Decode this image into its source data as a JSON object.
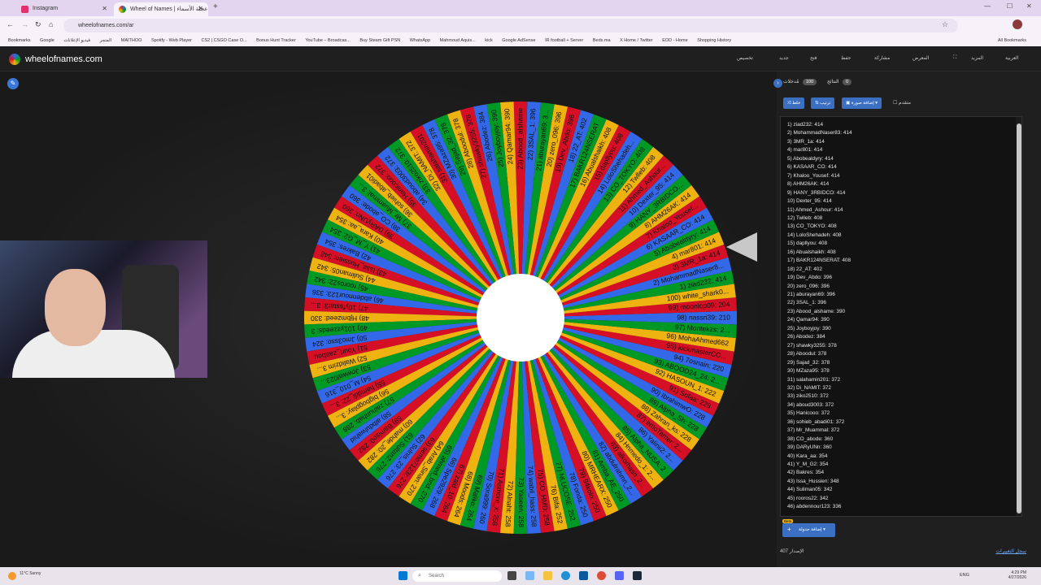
{
  "browser": {
    "tabs": [
      {
        "title": "Instagram",
        "active": false
      },
      {
        "title": "Wheel of Names | عجلة الأسماء",
        "active": true
      }
    ],
    "url": "wheelofnames.com/ar",
    "bookmarks": [
      "Bookmarks",
      "Google",
      "فيديو الإعلانات",
      "المتجر",
      "MAITHOO",
      "Spotify - Web Player",
      "CS2 | CSGO Case O...",
      "Bonus Hunt Tracker",
      "YouTube – Broadcas...",
      "Buy Steam Gift PSN",
      "WhatsApp",
      "Mahmoud Aquis...",
      "kick",
      "Google AdSense",
      "IR football + Server",
      "Beds.ma",
      "X Home / Twitter",
      "EOD - Home",
      "Shopping History",
      "All Bookmarks"
    ]
  },
  "app": {
    "site_name": "wheelofnames.com",
    "header_items": [
      "تخصيص",
      "جديد",
      "فتح",
      "حفظ",
      "مشاركة",
      "المعرض",
      "المزيد",
      "العربية"
    ]
  },
  "panel": {
    "tab_entries": "مُدخلات",
    "tab_entries_count": "100",
    "tab_results": "النتائج",
    "tab_results_count": "0",
    "btn_shuffle": "خلط",
    "btn_sort": "ترتيب",
    "btn_add_image": "إضافة صورة",
    "advanced_label": "متقدم",
    "beta": "Beta",
    "add_sheet": "إضافة جدولة",
    "version": "407 الإصدار",
    "changelog": "سجل التغييرات"
  },
  "entries": [
    "1) ziad232: 414",
    "2) MohammadNaser83: 414",
    "3) 3MR_1a: 414",
    "4) mar801: 414",
    "5) Abobealdyry: 414",
    "6) KASAAR_CO: 414",
    "7) Khaloo_Yousef: 414",
    "8) AHM26AK: 414",
    "9) HANY_3RBIDCO: 414",
    "10) Dexter_95: 414",
    "11) Ahmed_Ashour: 414",
    "12) Twlleb: 408",
    "13) CO_TOKYO: 408",
    "14) LoloShehadeh: 408",
    "15) dapllyou: 408",
    "16) Abualshaikh: 408",
    "17) BAKR124NSERAT: 408",
    "18) 22_AT: 402",
    "19) Dev_Abdo: 396",
    "20) zero_096: 396",
    "21) aburayan69: 396",
    "22) 3SAL_1: 396",
    "23) Abood_alshame: 390",
    "24) Qamar94: 390",
    "25) Joyboyjoy: 390",
    "26) Abodez: 384",
    "27) shawky3255: 378",
    "28) Aboodul: 378",
    "29) Sajad_32: 378",
    "30) MZaza95: 378",
    "31) salahamin201: 372",
    "32) Di_NAMIT: 372",
    "33) ziko2510: 372",
    "34) aboud3003: 372",
    "35) Hanicooo: 372",
    "36) sohieb_abadi01: 372",
    "37) Mr_Muammal: 372",
    "38) CO_abode: 360",
    "39) DARyUNn: 360",
    "40) Kara_aa: 354",
    "41) Y_M_G2: 354",
    "42) Bakres: 354",
    "43) Issa_Hussien: 348",
    "44) Suliman05: 342",
    "45) rooros22: 342",
    "46) abdennour123: 336"
  ],
  "wheel": {
    "segment_count": 100,
    "colors": [
      "#3369e8",
      "#d50f25",
      "#eeb211",
      "#009925"
    ],
    "visible_labels": [
      {
        "n": 97,
        "text": "97) Montekzs: 2..."
      },
      {
        "n": 98,
        "text": "98) nassri39: 210"
      },
      {
        "n": 99,
        "text": "99) moonlop09: 204"
      },
      {
        "n": 100,
        "text": "100) white_shark0..."
      },
      {
        "n": 1,
        "text": "1) ziad232: 414"
      },
      {
        "n": 2,
        "text": "2) MohammadNaser8..."
      },
      {
        "n": 3,
        "text": "3) 3MR_1a: 414"
      },
      {
        "n": 4,
        "text": "4) mar801: 414"
      },
      {
        "n": 5,
        "text": "5) Abobealdyry: 414"
      },
      {
        "n": 6,
        "text": "6) KASAAR_CO: 414"
      },
      {
        "n": 7,
        "text": "7) Khaloo_Yousef..."
      },
      {
        "n": 8,
        "text": "8) AHM26AK: 414"
      },
      {
        "n": 9,
        "text": "9) HANY_3RBIDCO..."
      },
      {
        "n": 10,
        "text": "10) Dexter_95: 414"
      },
      {
        "n": 11,
        "text": "11) Ahmed_Ashour..."
      },
      {
        "n": 12,
        "text": "12) Twlleb: 408"
      },
      {
        "n": 13,
        "text": "13) CO_TOKYO: 408"
      },
      {
        "n": 14,
        "text": "14) LoloShehadeh..."
      },
      {
        "n": 15,
        "text": "15) dapllyou: 408"
      },
      {
        "n": 16,
        "text": "16) Abualshaikh: 408"
      },
      {
        "n": 17,
        "text": "17) BAKR124NSERAT"
      },
      {
        "n": 18,
        "text": "18) 22_AT: 402"
      },
      {
        "n": 19,
        "text": "19) Dev_Abdo: 396"
      },
      {
        "n": 20,
        "text": "20) zero_096: 396"
      },
      {
        "n": 21,
        "text": "21) aburayan69: 3..."
      },
      {
        "n": 22,
        "text": "22) 3SAL_1: 396"
      },
      {
        "n": 23,
        "text": "23) Abood_alshame"
      },
      {
        "n": 24,
        "text": "24) Qamar94: 390"
      },
      {
        "n": 25,
        "text": "25) Joyboyjoy: 390"
      },
      {
        "n": 26,
        "text": "26) Abodez: 384"
      },
      {
        "n": 27,
        "text": "27) shawky3255: 378"
      },
      {
        "n": 28,
        "text": "28) Aboodul: 378"
      },
      {
        "n": 29,
        "text": "29) Sajad_32: 378"
      },
      {
        "n": 30,
        "text": "30) MZaza95: 378"
      },
      {
        "n": 31,
        "text": "31) salahamin201"
      },
      {
        "n": 32,
        "text": "32) Di_NAMIT: 372"
      },
      {
        "n": 33,
        "text": "33) ziko2510: 372"
      },
      {
        "n": 34,
        "text": "34) aboud3003: 372"
      },
      {
        "n": 35,
        "text": "35) Hanicooo: 372"
      },
      {
        "n": 36,
        "text": "36) sohieb_abadi01"
      },
      {
        "n": 37,
        "text": "37) Mr_Muammal: 3..."
      },
      {
        "n": 38,
        "text": "38) CO_abode: 360"
      },
      {
        "n": 39,
        "text": "39) DARyUNn: 360"
      },
      {
        "n": 40,
        "text": "40) Kara_aa: 354"
      },
      {
        "n": 41,
        "text": "41) Y_M_G2: 354"
      },
      {
        "n": 42,
        "text": "42) Bakres: 354"
      },
      {
        "n": 43,
        "text": "43) Issa_Hussien: 348"
      },
      {
        "n": 44,
        "text": "44) Suliman05: 342"
      },
      {
        "n": 45,
        "text": "45) rooros22: 342"
      },
      {
        "n": 46,
        "text": "46) abdennour123: 336"
      },
      {
        "n": 47,
        "text": "47) 10yfsstar3: 3..."
      },
      {
        "n": 48,
        "text": "48) Hjbmzeed: 330"
      },
      {
        "n": 49,
        "text": "49) 101yzzeeds: 3"
      },
      {
        "n": 50,
        "text": "50) Jmo3sso: 324"
      },
      {
        "n": 51,
        "text": "51) Yourl_zaabou"
      },
      {
        "n": 52,
        "text": "52) Walidzim 3..."
      },
      {
        "n": 53,
        "text": "53) Jowwal023..."
      },
      {
        "n": 54,
        "text": "54) M_010_316"
      },
      {
        "n": 55,
        "text": "55) hamddi_22: 3..."
      },
      {
        "n": 56,
        "text": "56) bigbogplay: 3..."
      },
      {
        "n": 57,
        "text": "57) zainunhab: 288"
      },
      {
        "n": 58,
        "text": "58) albdulwahid"
      },
      {
        "n": 59,
        "text": "59) Bamiso0: 282"
      },
      {
        "n": 60,
        "text": "60) mahde_20: 282"
      },
      {
        "n": 61,
        "text": "61) Sultan2: 276"
      },
      {
        "n": 62,
        "text": "62) Sulnis_23: 276"
      },
      {
        "n": 63,
        "text": "63) semo7123i: 276"
      },
      {
        "n": 64,
        "text": "64) Arab_Sinan: 270"
      },
      {
        "n": 65,
        "text": "65) ahmed_bnd: 270"
      },
      {
        "n": 66,
        "text": "66) Spe2929: 268"
      },
      {
        "n": 67,
        "text": "67) zaid_10: 264"
      },
      {
        "n": 68,
        "text": "68) Moods: 264"
      },
      {
        "n": 69,
        "text": "69) Maliko: 264"
      },
      {
        "n": 70,
        "text": "70) Sora999: 260"
      },
      {
        "n": 71,
        "text": "71) Asmore_x: 258"
      },
      {
        "n": 72,
        "text": "72) Alnaht: 258"
      },
      {
        "n": 73,
        "text": "73) Yaseen: 258"
      },
      {
        "n": 74,
        "text": "74) wabil_hass: 258"
      },
      {
        "n": 75,
        "text": "75) CO_HMD: 258"
      },
      {
        "n": 76,
        "text": "76) Bifa: 252"
      },
      {
        "n": 77,
        "text": "77) NLUCOSE: 252"
      },
      {
        "n": 78,
        "text": "78) Fonda: 250"
      },
      {
        "n": 79,
        "text": "79) 94kolo: 250"
      },
      {
        "n": 80,
        "text": "80) MRHEARX: 250"
      },
      {
        "n": 81,
        "text": "81) Amba_AE_250"
      },
      {
        "n": 82,
        "text": "82) abdulrahmn_2..."
      },
      {
        "n": 83,
        "text": "83) alkorhasn_2..."
      },
      {
        "n": 84,
        "text": "84) Hnmedo_1: 2..."
      },
      {
        "n": 85,
        "text": "85) Alpha_NUSA: 2"
      },
      {
        "n": 86,
        "text": "86) Yalinii2: 2..."
      },
      {
        "n": 87,
        "text": "87) emoTamer: 2..."
      },
      {
        "n": 88,
        "text": "88) Zahran_ks: 228"
      },
      {
        "n": 89,
        "text": "89) Alpha_Sh: 228"
      },
      {
        "n": 90,
        "text": "90) IbrahimwO: 228"
      },
      {
        "n": 91,
        "text": "91) Sofaa: 228"
      },
      {
        "n": 92,
        "text": "92) HASOUN_1: 222"
      },
      {
        "n": 93,
        "text": "93) ABOOD24_24: 2..."
      },
      {
        "n": 94,
        "text": "94) 7osnain: 220"
      },
      {
        "n": 95,
        "text": "95) kickmasterCO..."
      },
      {
        "n": 96,
        "text": "96) MohaAhmed662"
      }
    ]
  },
  "taskbar": {
    "weather": "11°C Sunny",
    "search": "Search",
    "lang": "ENG",
    "time": "4:29 PM",
    "date": "4/27/2026"
  }
}
